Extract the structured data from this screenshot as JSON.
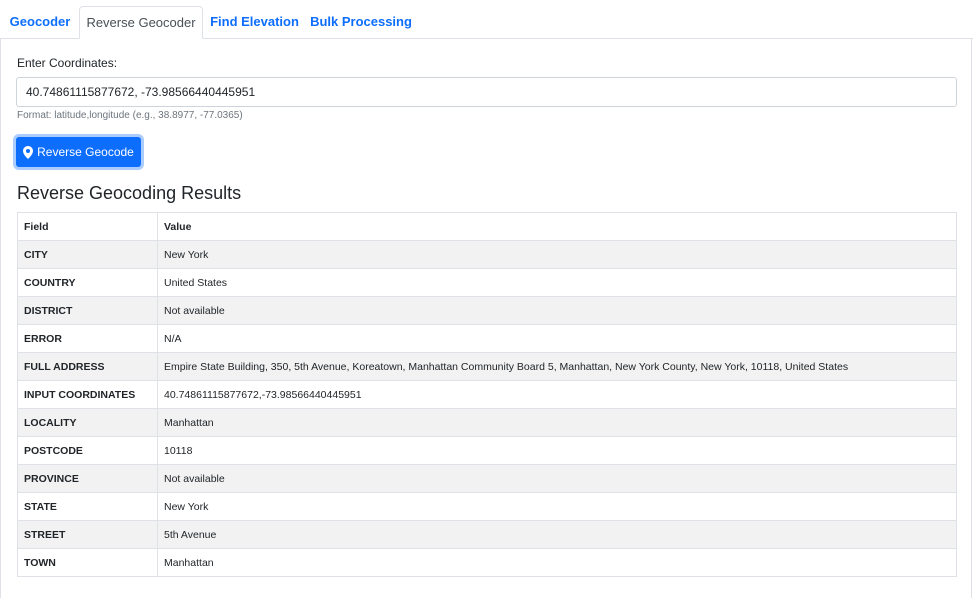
{
  "tabs": [
    {
      "label": "Geocoder",
      "active": false
    },
    {
      "label": "Reverse Geocoder",
      "active": true
    },
    {
      "label": "Find Elevation",
      "active": false
    },
    {
      "label": "Bulk Processing",
      "active": false
    }
  ],
  "form": {
    "label": "Enter Coordinates:",
    "input_value": "40.74861115877672, -73.98566440445951",
    "hint": "Format: latitude,longitude (e.g., 38.8977, -77.0365)",
    "button_label": "Reverse Geocode",
    "button_icon": "map-marker-icon"
  },
  "results": {
    "heading": "Reverse Geocoding Results",
    "columns": [
      "Field",
      "Value"
    ],
    "rows": [
      {
        "field": "CITY",
        "value": "New York"
      },
      {
        "field": "COUNTRY",
        "value": "United States"
      },
      {
        "field": "DISTRICT",
        "value": "Not available"
      },
      {
        "field": "ERROR",
        "value": "N/A"
      },
      {
        "field": "FULL ADDRESS",
        "value": "Empire State Building, 350, 5th Avenue, Koreatown, Manhattan Community Board 5, Manhattan, New York County, New York, 10118, United States"
      },
      {
        "field": "INPUT COORDINATES",
        "value": "40.74861115877672,-73.98566440445951"
      },
      {
        "field": "LOCALITY",
        "value": "Manhattan"
      },
      {
        "field": "POSTCODE",
        "value": "10118"
      },
      {
        "field": "PROVINCE",
        "value": "Not available"
      },
      {
        "field": "STATE",
        "value": "New York"
      },
      {
        "field": "STREET",
        "value": "5th Avenue"
      },
      {
        "field": "TOWN",
        "value": "Manhattan"
      }
    ]
  },
  "colors": {
    "accent": "#0d6efd",
    "stripe": "#f2f2f2",
    "border": "#dee2e6"
  }
}
